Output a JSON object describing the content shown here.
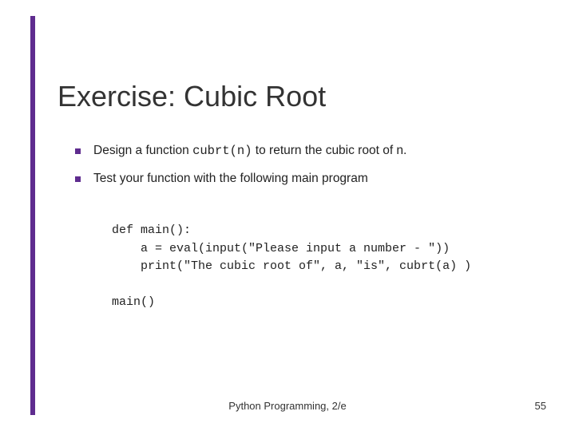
{
  "slide": {
    "title": "Exercise: Cubic Root",
    "bullets": [
      {
        "pre": "Design a function ",
        "code": "cubrt(n)",
        "post": " to return the cubic root of n."
      },
      {
        "pre": "Test your function with the following main program",
        "code": "",
        "post": ""
      }
    ],
    "code": "def main():\n    a = eval(input(\"Please input a number - \"))\n    print(\"The cubic root of\", a, \"is\", cubrt(a) )\n\nmain()",
    "footer_center": "Python Programming, 2/e",
    "footer_right": "55"
  }
}
